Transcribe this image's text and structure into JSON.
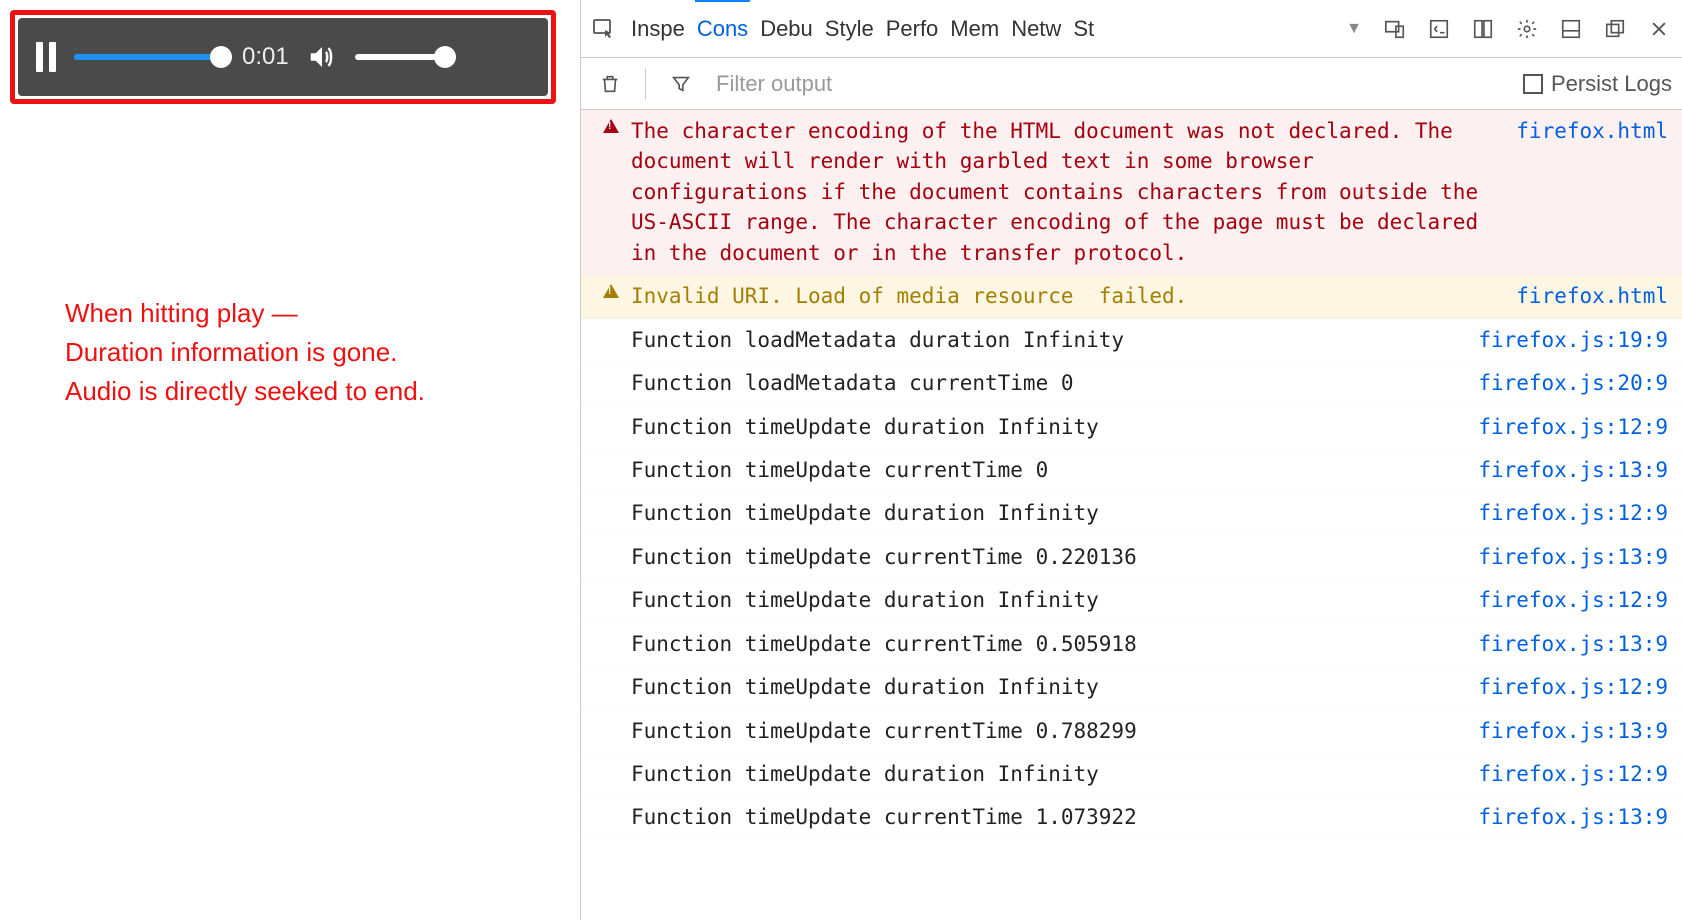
{
  "player": {
    "time": "0:01"
  },
  "annotation": {
    "line1": "When hitting play —",
    "line2": "Duration information is gone.",
    "line3": "Audio is directly seeked to end."
  },
  "devtools": {
    "tabs": [
      "Inspe",
      "Cons",
      "Debu",
      "Style",
      "Perfo",
      "Mem",
      "Netw",
      "St"
    ],
    "activeTab": 1,
    "filterPlaceholder": "Filter output",
    "persistLabel": "Persist Logs"
  },
  "messages": [
    {
      "kind": "warn-error",
      "text": "The character encoding of the HTML document was not declared. The document will render with garbled text in some browser configurations if the document contains characters from outside the US-ASCII range. The character encoding of the page must be declared in the document or in the transfer protocol.",
      "source": "firefox.html",
      "loc": ""
    },
    {
      "kind": "warn",
      "text": "Invalid URI. Load of media resource  failed.",
      "source": "firefox.html",
      "loc": ""
    },
    {
      "kind": "log",
      "text": "Function loadMetadata duration Infinity",
      "source": "firefox.js",
      "loc": ":19:9"
    },
    {
      "kind": "log",
      "text": "Function loadMetadata currentTime 0",
      "source": "firefox.js",
      "loc": ":20:9"
    },
    {
      "kind": "log",
      "text": "Function timeUpdate duration Infinity",
      "source": "firefox.js",
      "loc": ":12:9"
    },
    {
      "kind": "log",
      "text": "Function timeUpdate currentTime 0",
      "source": "firefox.js",
      "loc": ":13:9"
    },
    {
      "kind": "log",
      "text": "Function timeUpdate duration Infinity",
      "source": "firefox.js",
      "loc": ":12:9"
    },
    {
      "kind": "log",
      "text": "Function timeUpdate currentTime 0.220136",
      "source": "firefox.js",
      "loc": ":13:9"
    },
    {
      "kind": "log",
      "text": "Function timeUpdate duration Infinity",
      "source": "firefox.js",
      "loc": ":12:9"
    },
    {
      "kind": "log",
      "text": "Function timeUpdate currentTime 0.505918",
      "source": "firefox.js",
      "loc": ":13:9"
    },
    {
      "kind": "log",
      "text": "Function timeUpdate duration Infinity",
      "source": "firefox.js",
      "loc": ":12:9"
    },
    {
      "kind": "log",
      "text": "Function timeUpdate currentTime 0.788299",
      "source": "firefox.js",
      "loc": ":13:9"
    },
    {
      "kind": "log",
      "text": "Function timeUpdate duration Infinity",
      "source": "firefox.js",
      "loc": ":12:9"
    },
    {
      "kind": "log",
      "text": "Function timeUpdate currentTime 1.073922",
      "source": "firefox.js",
      "loc": ":13:9"
    }
  ]
}
